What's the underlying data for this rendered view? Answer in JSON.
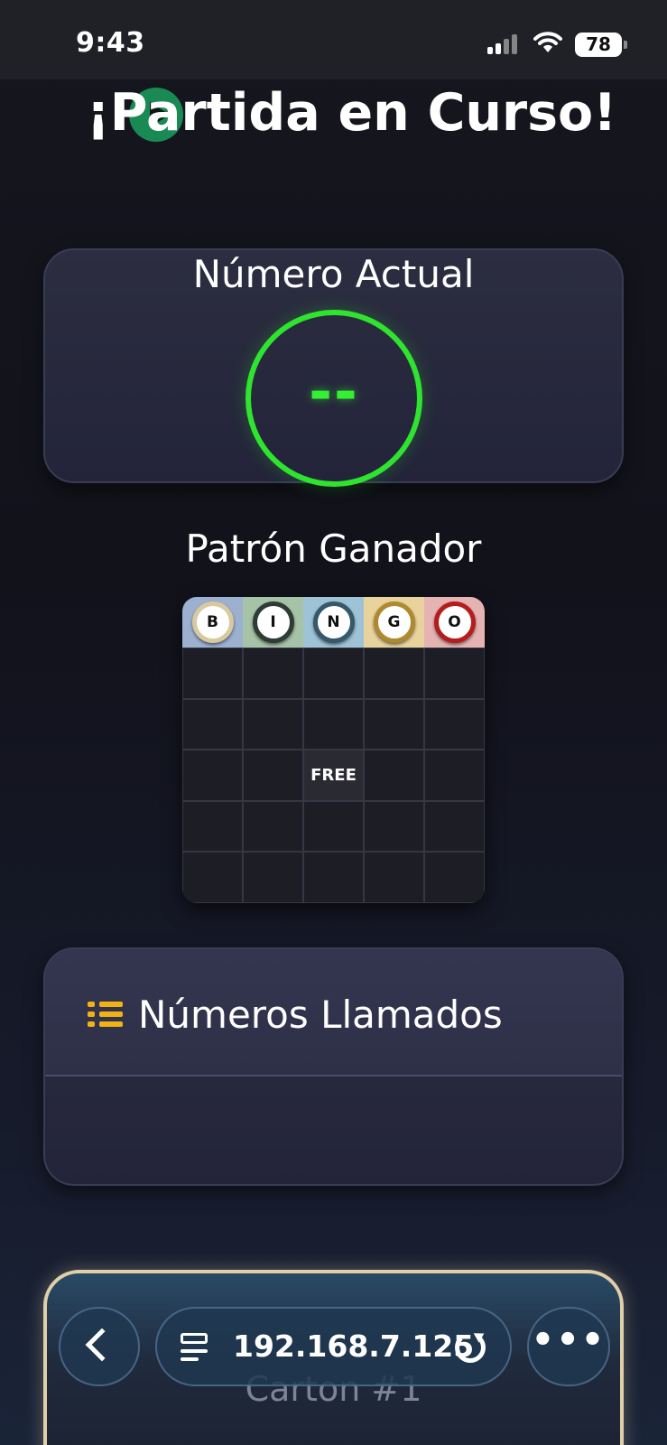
{
  "status_bar": {
    "time": "9:43",
    "battery": "78"
  },
  "heading": {
    "title": "¡Partida en Curso!",
    "icon": "play-circle-icon"
  },
  "current_number": {
    "label": "Número Actual",
    "value": "--",
    "accent_color": "#2ee42e"
  },
  "winning_pattern": {
    "label": "Patrón Ganador",
    "columns": [
      {
        "letter": "B",
        "ring": "#d9c9a0",
        "bg": "#9cb0d0"
      },
      {
        "letter": "I",
        "ring": "#2f3b36",
        "bg": "#a7c3a7"
      },
      {
        "letter": "N",
        "ring": "#35586a",
        "bg": "#9ec3d6"
      },
      {
        "letter": "G",
        "ring": "#b0892e",
        "bg": "#e8d39c"
      },
      {
        "letter": "O",
        "ring": "#b51c1c",
        "bg": "#e6b3b3"
      }
    ],
    "free_label": "FREE"
  },
  "called_numbers": {
    "label": "Números Llamados",
    "icon": "list-icon"
  },
  "carton": {
    "label": "Carton #1"
  },
  "browser": {
    "url": "192.168.7.125",
    "more": "•••"
  }
}
